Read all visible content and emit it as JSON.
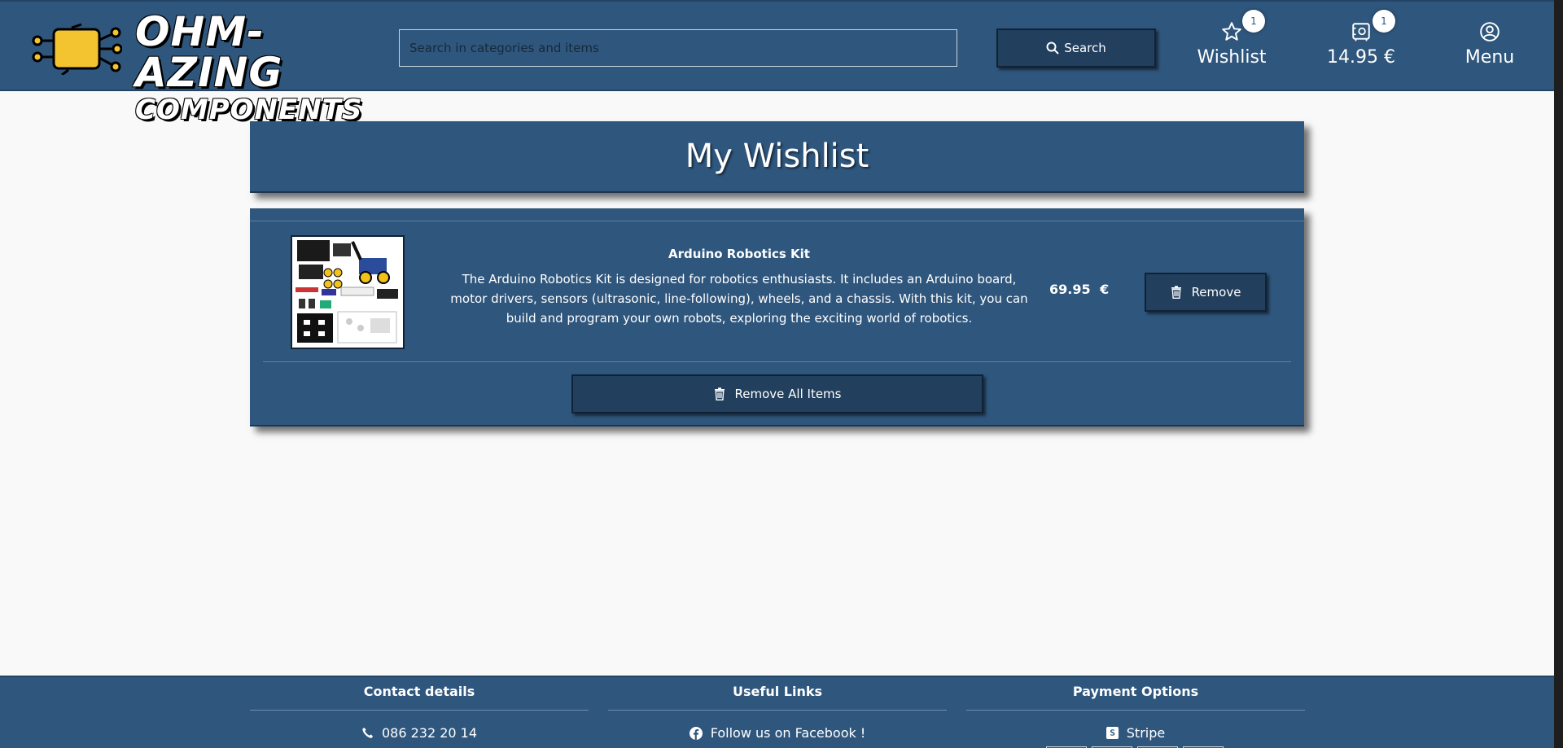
{
  "header": {
    "logo_line1": "OHM-AZING",
    "logo_line2": "COMPONENTS",
    "search_placeholder": "Search in categories and items",
    "search_button": "Search",
    "wishlist_label": "Wishlist",
    "wishlist_count": "1",
    "cart_total": "14.95 €",
    "cart_count": "1",
    "menu_label": "Menu"
  },
  "page": {
    "title": "My Wishlist"
  },
  "wishlist": {
    "items": [
      {
        "name": "Arduino Robotics Kit",
        "description": "The Arduino Robotics Kit is designed for robotics enthusiasts. It includes an Arduino board, motor drivers, sensors (ultrasonic, line-following), wheels, and a chassis. With this kit, you can build and program your own robots, exploring the exciting world of robotics.",
        "price": "69.95 €",
        "remove_label": "Remove"
      }
    ],
    "remove_all_label": "Remove All Items"
  },
  "footer": {
    "contact_heading": "Contact details",
    "phone": "086 232 20 14",
    "links_heading": "Useful Links",
    "facebook": "Follow us on Facebook !",
    "payment_heading": "Payment Options",
    "stripe": "Stripe"
  },
  "colors": {
    "primary": "#2f567d",
    "button": "#223f5d",
    "background": "#f9f9f9",
    "logo_yellow": "#f4c430"
  },
  "icons": [
    "search-icon",
    "star-icon",
    "cart-icon",
    "user-icon",
    "trash-icon",
    "phone-icon",
    "facebook-icon",
    "stripe-icon"
  ]
}
